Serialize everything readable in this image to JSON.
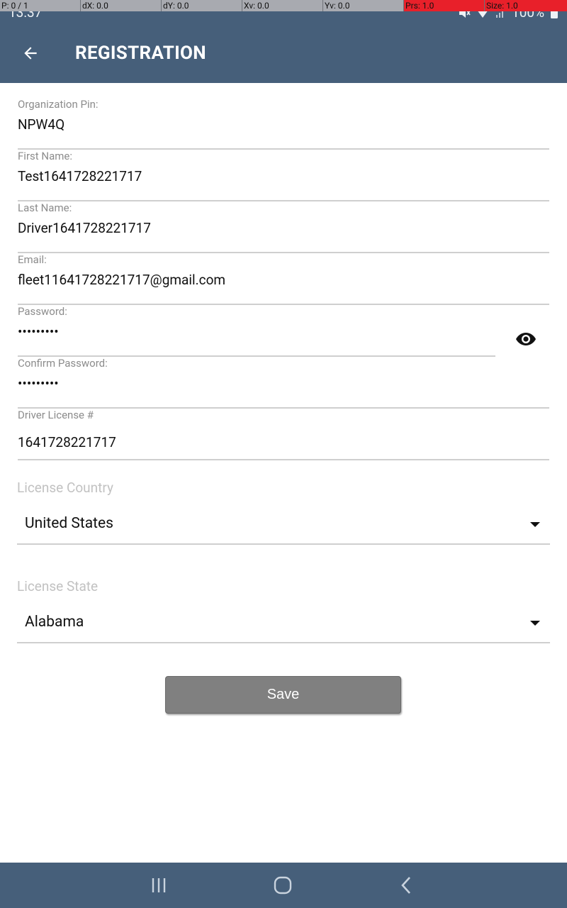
{
  "debug": {
    "cells": [
      "P: 0 / 1",
      "dX: 0.0",
      "dY: 0.0",
      "Xv: 0.0",
      "Yv: 0.0",
      "Prs: 1.0",
      "Size: 1.0"
    ]
  },
  "status": {
    "time": "13:37",
    "battery": "100%"
  },
  "header": {
    "title": "REGISTRATION"
  },
  "form": {
    "org_pin": {
      "label": "Organization Pin:",
      "value": "NPW4Q"
    },
    "first_name": {
      "label": "First Name:",
      "value": "Test1641728221717"
    },
    "last_name": {
      "label": "Last Name:",
      "value": "Driver1641728221717"
    },
    "email": {
      "label": "Email:",
      "value": "fleet11641728221717@gmail.com"
    },
    "password": {
      "label": "Password:",
      "value": "•••••••••"
    },
    "confirm_password": {
      "label": "Confirm Password:",
      "value": "•••••••••"
    },
    "driver_license": {
      "label": "Driver License #",
      "value": "1641728221717"
    },
    "license_country": {
      "label": "License Country",
      "value": "United States"
    },
    "license_state": {
      "label": "License State",
      "value": "Alabama"
    },
    "save_label": "Save"
  },
  "colors": {
    "app_bar": "#465f7a",
    "button": "#808080"
  }
}
